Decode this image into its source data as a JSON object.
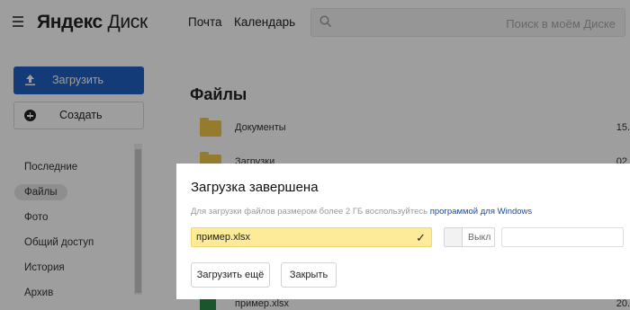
{
  "header": {
    "logo_bold": "Яндекс",
    "logo_light": "Диск",
    "nav": [
      "Почта",
      "Календарь"
    ],
    "search_placeholder": "Поиск в моём Диске"
  },
  "sidebar": {
    "upload_label": "Загрузить",
    "create_label": "Создать",
    "items": [
      {
        "label": "Последние",
        "active": false
      },
      {
        "label": "Файлы",
        "active": true
      },
      {
        "label": "Фото",
        "active": false
      },
      {
        "label": "Общий доступ",
        "active": false
      },
      {
        "label": "История",
        "active": false
      },
      {
        "label": "Архив",
        "active": false
      }
    ]
  },
  "main": {
    "title": "Файлы",
    "files": [
      {
        "name": "Документы",
        "date": "15."
      },
      {
        "name": "Загрузки",
        "date": "02."
      }
    ],
    "bottom_file": {
      "name": "пример.xlsx",
      "date": "20."
    }
  },
  "dialog": {
    "title": "Загрузка завершена",
    "hint_text": "Для загрузки файлов размером более 2 ГБ воспользуйтесь ",
    "hint_link": "программой для Windows",
    "file_name": "пример.xlsx",
    "check_icon": "✓",
    "toggle_label": "Выкл",
    "link_value": "",
    "upload_more_label": "Загрузить ещё",
    "close_label": "Закрыть"
  },
  "colors": {
    "accent": "#1f5fc2",
    "file_highlight": "#fdeb9a",
    "link": "#1b4ba8",
    "folder": "#f0c84a"
  }
}
